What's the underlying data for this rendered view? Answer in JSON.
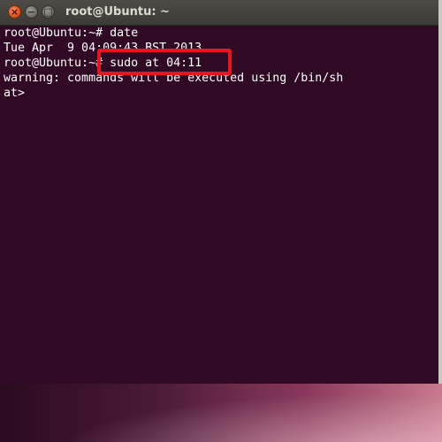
{
  "window": {
    "title": "root@Ubuntu: ~",
    "close_glyph": "×",
    "minimize_glyph": "−",
    "maximize_glyph": "□"
  },
  "terminal": {
    "lines": [
      "root@Ubuntu:~# date",
      "Tue Apr  9 04:09:43 BST 2013",
      "root@Ubuntu:~# sudo at 04:11",
      "warning: commands will be executed using /bin/sh",
      "at>"
    ],
    "background_color": "#300a24",
    "text_color": "#ffffff"
  },
  "annotation": {
    "highlight_color": "#e8141e"
  }
}
